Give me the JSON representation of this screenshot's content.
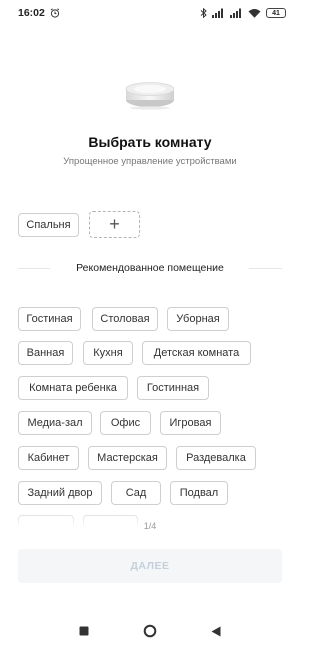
{
  "status_bar": {
    "time": "16:02",
    "battery": "41"
  },
  "header": {
    "title": "Выбрать комнату",
    "subtitle": "Упрощенное управление устройствами"
  },
  "my_rooms": {
    "items": [
      {
        "label": "Спальня"
      }
    ],
    "add_label": "+"
  },
  "recommended": {
    "heading": "Рекомендованное помещение",
    "items": [
      {
        "label": "Гостиная"
      },
      {
        "label": "Столовая"
      },
      {
        "label": "Уборная"
      },
      {
        "label": "Ванная"
      },
      {
        "label": "Кухня"
      },
      {
        "label": "Детская комната"
      },
      {
        "label": "Комната ребенка"
      },
      {
        "label": "Гостинная"
      },
      {
        "label": "Медиа-зал"
      },
      {
        "label": "Офис"
      },
      {
        "label": "Игровая"
      },
      {
        "label": "Кабинет"
      },
      {
        "label": "Мастерская"
      },
      {
        "label": "Раздевалка"
      },
      {
        "label": "Задний двор"
      },
      {
        "label": "Сад"
      },
      {
        "label": "Подвал"
      }
    ]
  },
  "pager": "1/4",
  "footer": {
    "next_label": "ДАЛЕЕ"
  },
  "colors": {
    "chip_border": "#cfcfcf",
    "button_bg": "#f5f6f8",
    "button_text": "#c4d0dc"
  }
}
